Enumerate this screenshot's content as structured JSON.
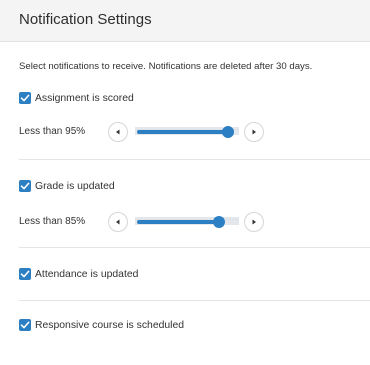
{
  "header": {
    "title": "Notification Settings"
  },
  "intro_text": "Select notifications to receive. Notifications are deleted after 30 days.",
  "notifications": [
    {
      "label": "Assignment is scored",
      "checked": true,
      "threshold": {
        "label": "Less than 95%",
        "value_percent": 95
      }
    },
    {
      "label": "Grade is updated",
      "checked": true,
      "threshold": {
        "label": "Less than 85%",
        "value_percent": 85
      }
    },
    {
      "label": "Attendance is updated",
      "checked": true
    },
    {
      "label": "Responsive course is scheduled",
      "checked": true
    }
  ],
  "icons": {
    "checkbox": "checkmark-icon",
    "decrease": "triangle-left-icon",
    "increase": "triangle-right-icon"
  },
  "colors": {
    "accent": "#2d7fc3",
    "header_bg": "#f4f4f4",
    "divider": "#e4e4e4"
  }
}
